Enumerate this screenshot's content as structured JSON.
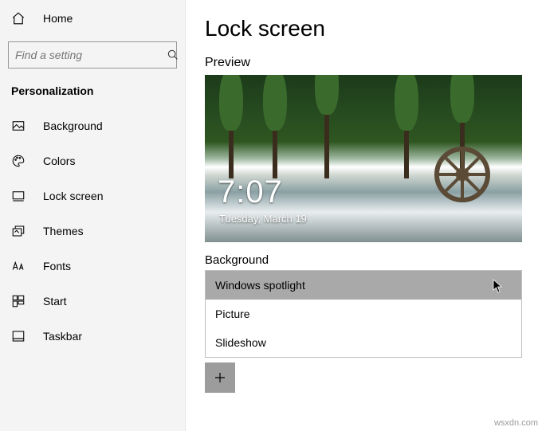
{
  "sidebar": {
    "home_label": "Home",
    "search_placeholder": "Find a setting",
    "section_title": "Personalization",
    "items": [
      {
        "label": "Background"
      },
      {
        "label": "Colors"
      },
      {
        "label": "Lock screen"
      },
      {
        "label": "Themes"
      },
      {
        "label": "Fonts"
      },
      {
        "label": "Start"
      },
      {
        "label": "Taskbar"
      }
    ]
  },
  "main": {
    "title": "Lock screen",
    "preview_label": "Preview",
    "clock_time": "7:07",
    "clock_date": "Tuesday, March 19",
    "background_label": "Background",
    "dropdown": {
      "options": [
        "Windows spotlight",
        "Picture",
        "Slideshow"
      ],
      "selected_index": 0
    }
  },
  "watermark": "wsxdn.com"
}
